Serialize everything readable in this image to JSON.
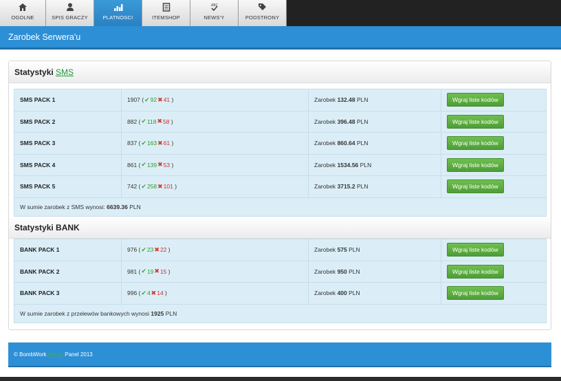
{
  "nav": {
    "tabs": [
      {
        "label": "OGOLNE",
        "icon": "home-icon"
      },
      {
        "label": "SPIS GRACZY",
        "icon": "user-icon"
      },
      {
        "label": "PLATNOSCI",
        "icon": "chart-icon"
      },
      {
        "label": "ITEMSHOP",
        "icon": "document-icon"
      },
      {
        "label": "NEWS'Y",
        "icon": "abc-check-icon"
      },
      {
        "label": "PODSTRONY",
        "icon": "tag-icon"
      }
    ],
    "active": "PLATNOSCI"
  },
  "header": {
    "title": "Zarobek Serwera'u"
  },
  "sms": {
    "title_prefix": "Statystyki",
    "title_link": "SMS",
    "rows": [
      {
        "name": "SMS PACK 1",
        "total": "1907",
        "ok": "92",
        "bad": "41",
        "earn_label": "Zarobek",
        "earn_value": "132.48",
        "currency": "PLN",
        "button": "Wgraj liste kodów"
      },
      {
        "name": "SMS PACK 2",
        "total": "882",
        "ok": "118",
        "bad": "58",
        "earn_label": "Zarobek",
        "earn_value": "396.48",
        "currency": "PLN",
        "button": "Wgraj liste kodów"
      },
      {
        "name": "SMS PACK 3",
        "total": "837",
        "ok": "163",
        "bad": "61",
        "earn_label": "Zarobek",
        "earn_value": "860.64",
        "currency": "PLN",
        "button": "Wgraj liste kodów"
      },
      {
        "name": "SMS PACK 4",
        "total": "861",
        "ok": "139",
        "bad": "53",
        "earn_label": "Zarobek",
        "earn_value": "1534.56",
        "currency": "PLN",
        "button": "Wgraj liste kodów"
      },
      {
        "name": "SMS PACK 5",
        "total": "742",
        "ok": "258",
        "bad": "101",
        "earn_label": "Zarobek",
        "earn_value": "3715.2",
        "currency": "PLN",
        "button": "Wgraj liste kodów"
      }
    ],
    "summary_text": "W sumie zarobek z SMS wynosi:",
    "summary_value": "6639.36",
    "summary_currency": "PLN"
  },
  "bank": {
    "title": "Statystyki BANK",
    "rows": [
      {
        "name": "BANK PACK 1",
        "total": "976",
        "ok": "23",
        "bad": "22",
        "earn_label": "Zarobek",
        "earn_value": "575",
        "currency": "PLN",
        "button": "Wgraj liste kodów"
      },
      {
        "name": "BANK PACK 2",
        "total": "981",
        "ok": "19",
        "bad": "15",
        "earn_label": "Zarobek",
        "earn_value": "950",
        "currency": "PLN",
        "button": "Wgraj liste kodów"
      },
      {
        "name": "BANK PACK 3",
        "total": "996",
        "ok": "4",
        "bad": "14",
        "earn_label": "Zarobek",
        "earn_value": "400",
        "currency": "PLN",
        "button": "Wgraj liste kodów"
      }
    ],
    "summary_text": "W sumie zarobek z przelewów bankowych wynosi",
    "summary_value": "1925",
    "summary_currency": "PLN"
  },
  "footer": {
    "prefix": "© BombWork",
    "link": "Admin",
    "suffix": "Panel 2013"
  },
  "colors": {
    "accent": "#2d8fd5",
    "ok": "#2e9b2e",
    "bad": "#d12c2c",
    "button": "#5aad3f",
    "table_bg": "#dbeef7"
  }
}
